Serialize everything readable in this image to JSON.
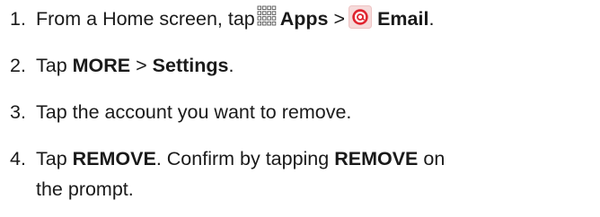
{
  "steps": [
    {
      "number": "1.",
      "text_a": "From a Home screen, tap",
      "apps_icon": "apps-grid-icon",
      "apps_label": "Apps",
      "separator": ">",
      "email_icon": "email-at-icon",
      "email_label": "Email",
      "end": "."
    },
    {
      "number": "2.",
      "bold_a": "MORE",
      "separator": ">",
      "bold_b": "Settings",
      "end": "."
    },
    {
      "number": "3.",
      "text": "Tap the account you want to remove."
    },
    {
      "number": "4.",
      "bold_a": "REMOVE",
      "text_a": ". Confirm by tapping",
      "bold_b": "REMOVE",
      "text_b": "on",
      "line2": "the prompt."
    }
  ],
  "colors": {
    "text": "#1a1a1a",
    "email_icon_bg": "#f6dada",
    "email_icon_ring": "#e0242f",
    "apps_icon_stroke": "#555555"
  }
}
